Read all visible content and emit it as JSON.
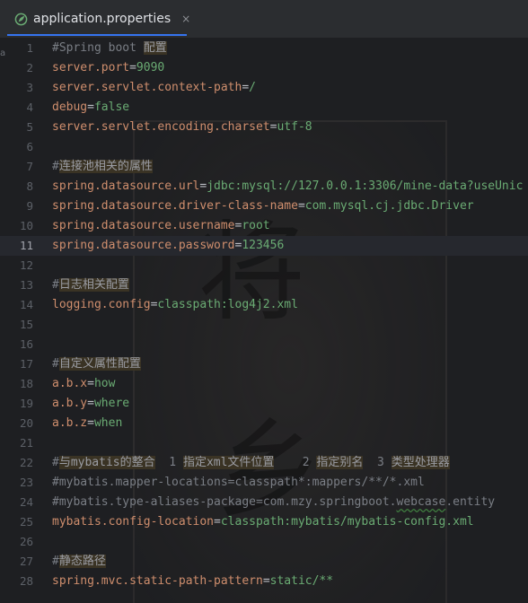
{
  "tab": {
    "title": "application.properties",
    "close": "×",
    "icon": "spring-leaf-icon"
  },
  "gutter_mark": "a",
  "current_line": 11,
  "colors": {
    "key": "#cf8e6d",
    "value": "#6aab73",
    "comment": "#7a7e85",
    "accent": "#3574f0"
  },
  "lines": [
    {
      "n": "1",
      "segs": [
        {
          "t": "#Spring boot ",
          "c": "c"
        },
        {
          "t": "配置",
          "c": "hl"
        }
      ]
    },
    {
      "n": "2",
      "segs": [
        {
          "t": "server.port",
          "c": "k"
        },
        {
          "t": "=",
          "c": "eq"
        },
        {
          "t": "9090",
          "c": "v"
        }
      ]
    },
    {
      "n": "3",
      "segs": [
        {
          "t": "server.servlet.context-path",
          "c": "k"
        },
        {
          "t": "=",
          "c": "eq"
        },
        {
          "t": "/",
          "c": "v"
        }
      ]
    },
    {
      "n": "4",
      "segs": [
        {
          "t": "debug",
          "c": "k"
        },
        {
          "t": "=",
          "c": "eq"
        },
        {
          "t": "false",
          "c": "v"
        }
      ]
    },
    {
      "n": "5",
      "segs": [
        {
          "t": "server.servlet.encoding.charset",
          "c": "k"
        },
        {
          "t": "=",
          "c": "eq"
        },
        {
          "t": "utf-8",
          "c": "v"
        }
      ]
    },
    {
      "n": "6",
      "segs": []
    },
    {
      "n": "7",
      "segs": [
        {
          "t": "#",
          "c": "c"
        },
        {
          "t": "连接池相关的属性",
          "c": "hl"
        }
      ]
    },
    {
      "n": "8",
      "segs": [
        {
          "t": "spring.datasource.url",
          "c": "k"
        },
        {
          "t": "=",
          "c": "eq"
        },
        {
          "t": "jdbc:mysql://127.0.0.1:3306/mine-data?useUnic",
          "c": "v"
        }
      ]
    },
    {
      "n": "9",
      "segs": [
        {
          "t": "spring.datasource.driver-class-name",
          "c": "k"
        },
        {
          "t": "=",
          "c": "eq"
        },
        {
          "t": "com.mysql.cj.jdbc.Driver",
          "c": "v"
        }
      ]
    },
    {
      "n": "10",
      "segs": [
        {
          "t": "spring.datasource.username",
          "c": "k"
        },
        {
          "t": "=",
          "c": "eq"
        },
        {
          "t": "root",
          "c": "v"
        }
      ]
    },
    {
      "n": "11",
      "segs": [
        {
          "t": "spring.datasource.password",
          "c": "k"
        },
        {
          "t": "=",
          "c": "eq"
        },
        {
          "t": "123456",
          "c": "v"
        }
      ]
    },
    {
      "n": "12",
      "segs": []
    },
    {
      "n": "13",
      "segs": [
        {
          "t": "#",
          "c": "c"
        },
        {
          "t": "日志相关配置",
          "c": "hl"
        }
      ]
    },
    {
      "n": "14",
      "segs": [
        {
          "t": "logging.config",
          "c": "k"
        },
        {
          "t": "=",
          "c": "eq"
        },
        {
          "t": "classpath:log4j2.xml",
          "c": "v"
        }
      ]
    },
    {
      "n": "15",
      "segs": []
    },
    {
      "n": "16",
      "segs": []
    },
    {
      "n": "17",
      "segs": [
        {
          "t": "#",
          "c": "c"
        },
        {
          "t": "自定义属性配置",
          "c": "hl"
        }
      ]
    },
    {
      "n": "18",
      "segs": [
        {
          "t": "a.b.x",
          "c": "k"
        },
        {
          "t": "=",
          "c": "eq"
        },
        {
          "t": "how",
          "c": "v"
        }
      ]
    },
    {
      "n": "19",
      "segs": [
        {
          "t": "a.b.y",
          "c": "k"
        },
        {
          "t": "=",
          "c": "eq"
        },
        {
          "t": "where",
          "c": "v"
        }
      ]
    },
    {
      "n": "20",
      "segs": [
        {
          "t": "a.b.z",
          "c": "k"
        },
        {
          "t": "=",
          "c": "eq"
        },
        {
          "t": "when",
          "c": "v"
        }
      ]
    },
    {
      "n": "21",
      "segs": []
    },
    {
      "n": "22",
      "segs": [
        {
          "t": "#",
          "c": "c"
        },
        {
          "t": "与mybatis的整合",
          "c": "hl"
        },
        {
          "t": "  1 ",
          "c": "c"
        },
        {
          "t": "指定xml文件位置",
          "c": "hl"
        },
        {
          "t": "    2 ",
          "c": "c"
        },
        {
          "t": "指定别名",
          "c": "hl"
        },
        {
          "t": "  3 ",
          "c": "c"
        },
        {
          "t": "类型处理器",
          "c": "hl"
        }
      ]
    },
    {
      "n": "23",
      "segs": [
        {
          "t": "#mybatis.mapper-locations=classpath*:mappers/**/*.xml",
          "c": "c"
        }
      ]
    },
    {
      "n": "24",
      "segs": [
        {
          "t": "#mybatis.type-aliases-package=com.mzy.springboot.",
          "c": "c"
        },
        {
          "t": "webcase",
          "c": "c squig"
        },
        {
          "t": ".entity",
          "c": "c"
        }
      ]
    },
    {
      "n": "25",
      "segs": [
        {
          "t": "mybatis.config-location",
          "c": "k"
        },
        {
          "t": "=",
          "c": "eq"
        },
        {
          "t": "classpath:mybatis/mybatis-config.xml",
          "c": "v"
        }
      ]
    },
    {
      "n": "26",
      "segs": []
    },
    {
      "n": "27",
      "segs": [
        {
          "t": "#",
          "c": "c"
        },
        {
          "t": "静态路径",
          "c": "hl"
        }
      ]
    },
    {
      "n": "28",
      "segs": [
        {
          "t": "spring.mvc.static-path-pattern",
          "c": "k"
        },
        {
          "t": "=",
          "c": "eq"
        },
        {
          "t": "static/**",
          "c": "v"
        }
      ]
    }
  ]
}
